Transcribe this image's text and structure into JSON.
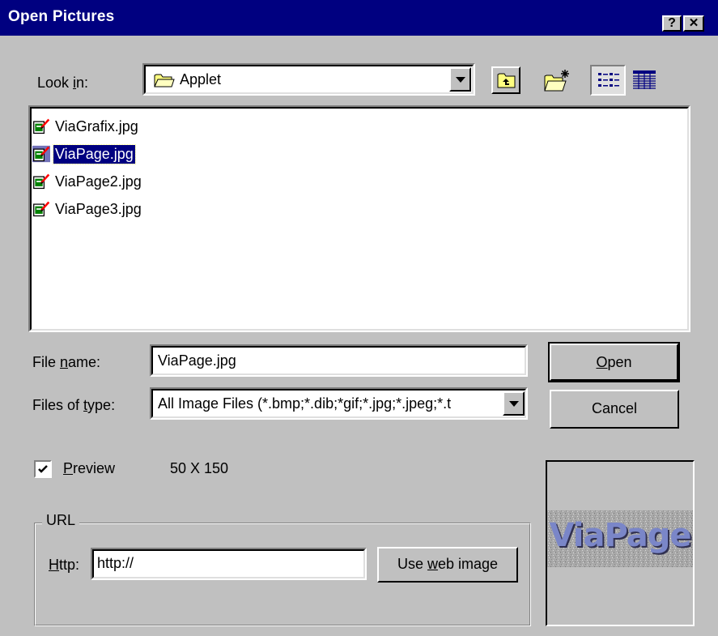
{
  "window": {
    "title": "Open Pictures",
    "help_glyph": "?",
    "close_glyph": "✕"
  },
  "toolbar": {
    "look_in_label_pre": "Look ",
    "look_in_label_u": "i",
    "look_in_label_post": "n:",
    "look_in_value": "Applet",
    "icons": [
      "folder-icon",
      "up-one-level-icon",
      "new-folder-icon",
      "list-view-icon",
      "details-view-icon"
    ]
  },
  "files": [
    {
      "name": "ViaGrafix.jpg",
      "selected": false
    },
    {
      "name": "ViaPage.jpg",
      "selected": true
    },
    {
      "name": "ViaPage2.jpg",
      "selected": false
    },
    {
      "name": "ViaPage3.jpg",
      "selected": false
    }
  ],
  "form": {
    "file_name_label_pre": "File ",
    "file_name_label_u": "n",
    "file_name_label_post": "ame:",
    "file_name_value": "ViaPage.jpg",
    "file_type_label_pre": "Files of ",
    "file_type_label_u": "t",
    "file_type_label_post": "ype:",
    "file_type_value": "All Image Files (*.bmp;*.dib;*gif;*.jpg;*.jpeg;*.t"
  },
  "buttons": {
    "open_u": "O",
    "open_rest": "pen",
    "cancel": "Cancel",
    "use_web_pre": "Use ",
    "use_web_u": "w",
    "use_web_post": "eb image"
  },
  "preview": {
    "checked": true,
    "label_u": "P",
    "label_rest": "review",
    "dimensions": "50 X 150",
    "image_text": "ViaPage"
  },
  "url": {
    "group_label": "URL",
    "http_label_u": "H",
    "http_label_rest": "ttp:",
    "http_value": "http://"
  }
}
